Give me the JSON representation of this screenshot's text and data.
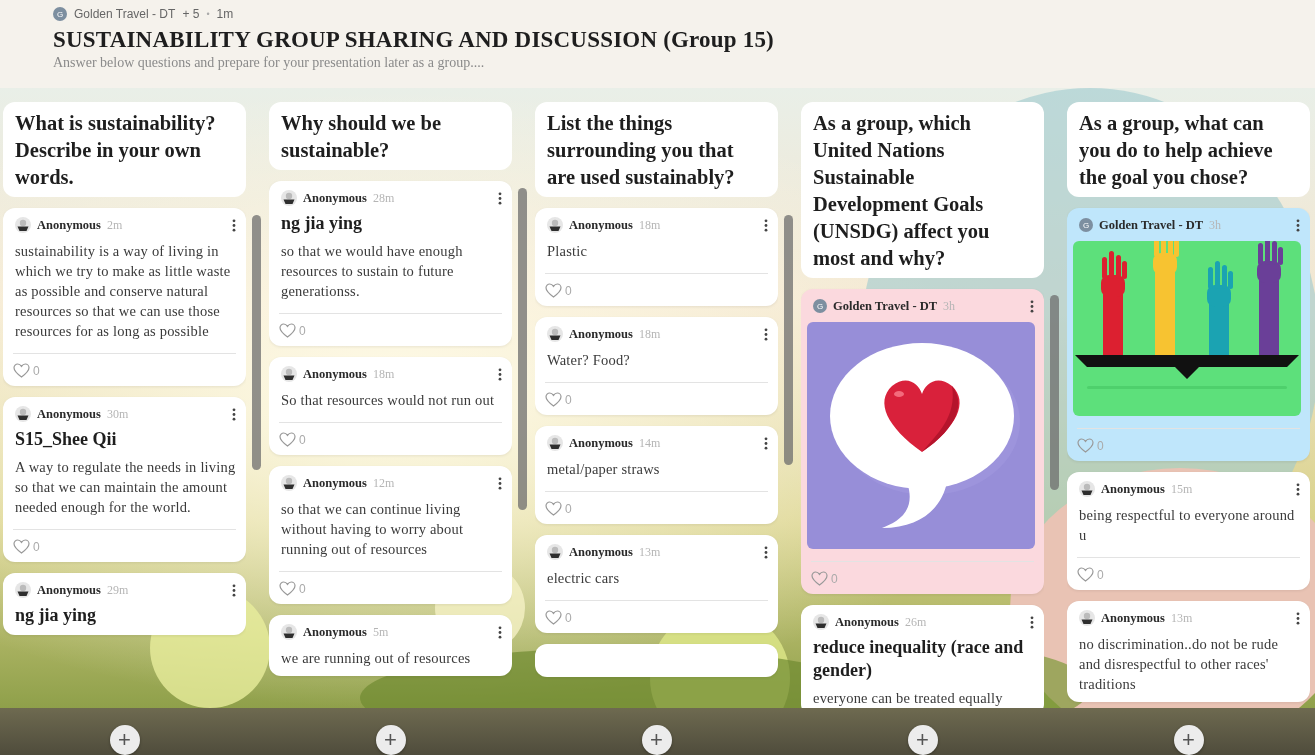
{
  "board": {
    "author_initial": "G",
    "author": "Golden Travel - DT",
    "contributors": "+ 5",
    "separator": "•",
    "time": "1m",
    "title": "SUSTAINABILITY GROUP SHARING AND DISCUSSION (Group 15)",
    "description": "Answer below questions and prepare for your presentation later as a group...."
  },
  "columns": [
    {
      "title": "What is sustainability? Describe in your own words.",
      "add_label": "+",
      "posts": [
        {
          "kind": "anonymous",
          "author": "Anonymous",
          "time": "2m",
          "body": "sustainability is a way of living in which we try to make as little waste as possible and conserve natural resources so that we can use those resources for as long as possible",
          "likes": "0",
          "color": "#ffffff"
        },
        {
          "kind": "anonymous",
          "author": "Anonymous",
          "time": "30m",
          "title": "S15_Shee Qii",
          "body": "A way to regulate the needs in living so that we can maintain the amount needed enough for the world.",
          "likes": "0",
          "color": "#ffffff"
        },
        {
          "kind": "anonymous",
          "author": "Anonymous",
          "time": "29m",
          "title": "ng jia ying",
          "color": "#ffffff"
        }
      ]
    },
    {
      "title": "Why should we be sustainable?",
      "add_label": "+",
      "posts": [
        {
          "kind": "anonymous",
          "author": "Anonymous",
          "time": "28m",
          "title": "ng jia ying",
          "body": "so that we would have enough resources to sustain to future generationss.",
          "likes": "0",
          "color": "#ffffff"
        },
        {
          "kind": "anonymous",
          "author": "Anonymous",
          "time": "18m",
          "body": "So that resources would not run out",
          "likes": "0",
          "color": "#ffffff"
        },
        {
          "kind": "anonymous",
          "author": "Anonymous",
          "time": "12m",
          "body": "so that we can continue living without having to worry about running out of resources",
          "likes": "0",
          "color": "#ffffff"
        },
        {
          "kind": "anonymous",
          "author": "Anonymous",
          "time": "5m",
          "body": "we are running out of resources",
          "color": "#ffffff"
        }
      ]
    },
    {
      "title": "List the things surrounding you that are used sustainably?",
      "add_label": "+",
      "posts": [
        {
          "kind": "anonymous",
          "author": "Anonymous",
          "time": "18m",
          "body": "Plastic",
          "likes": "0",
          "color": "#ffffff"
        },
        {
          "kind": "anonymous",
          "author": "Anonymous",
          "time": "18m",
          "body": "Water? Food?",
          "likes": "0",
          "color": "#ffffff"
        },
        {
          "kind": "anonymous",
          "author": "Anonymous",
          "time": "14m",
          "body": "metal/paper straws",
          "likes": "0",
          "color": "#ffffff"
        },
        {
          "kind": "anonymous",
          "author": "Anonymous",
          "time": "13m",
          "body": "electric cars",
          "likes": "0",
          "color": "#ffffff"
        },
        {
          "kind": "hidden",
          "color": "#ffffff"
        }
      ]
    },
    {
      "title": "As a group, which United Nations Sustainable Development Goals (UNSDG) affect you most and why?",
      "add_label": "+",
      "posts": [
        {
          "kind": "member",
          "initial": "G",
          "author": "Golden Travel - DT",
          "time": "3h",
          "likes": "0",
          "color": "#fbd9de"
        },
        {
          "kind": "anonymous",
          "author": "Anonymous",
          "time": "26m",
          "title": "reduce inequality (race and gender)",
          "body": "everyone can be treated equally",
          "color": "#ffffff"
        }
      ]
    },
    {
      "title": "As a group, what can you do to help achieve the goal you chose?",
      "add_label": "+",
      "posts": [
        {
          "kind": "member",
          "initial": "G",
          "author": "Golden Travel - DT",
          "time": "3h",
          "likes": "0",
          "color": "#bfe6fb"
        },
        {
          "kind": "anonymous",
          "author": "Anonymous",
          "time": "15m",
          "body": "being respectful to everyone around u",
          "likes": "0",
          "color": "#ffffff"
        },
        {
          "kind": "anonymous",
          "author": "Anonymous",
          "time": "13m",
          "body": "no discrimination..do not be rude and disrespectful to other races' traditions",
          "color": "#ffffff"
        }
      ]
    }
  ]
}
